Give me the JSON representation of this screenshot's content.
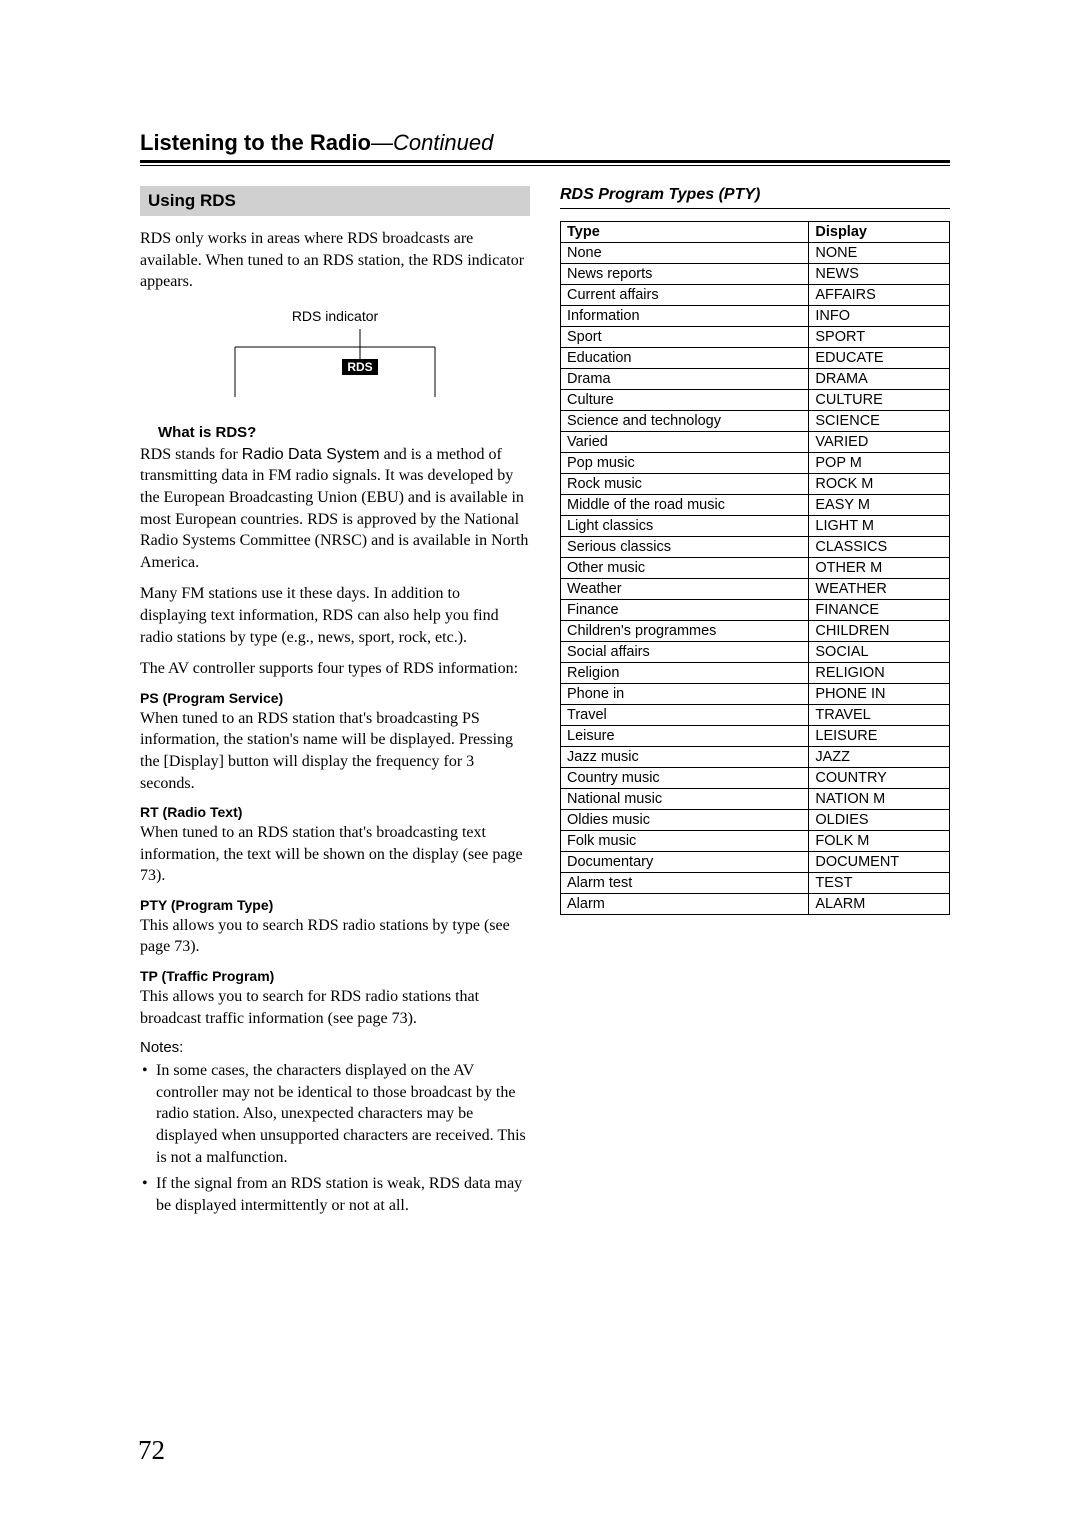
{
  "page": {
    "title_bold": "Listening to the Radio",
    "title_sep": "—",
    "title_continued": "Continued",
    "number": "72"
  },
  "left": {
    "section_header": "Using RDS",
    "intro": "RDS only works in areas where RDS broadcasts are available. When tuned to an RDS station, the RDS indicator appears.",
    "diagram_label": "RDS indicator",
    "rds_badge": "RDS",
    "what_is_heading": "What is RDS?",
    "what_is_p1_a": "RDS stands for ",
    "what_is_p1_b": "Radio Data System",
    "what_is_p1_c": " and is a method of transmitting data in FM radio signals. It was developed by the European Broadcasting Union (EBU) and is available in most European countries. RDS is approved by the National Radio Systems Committee (NRSC) and is available in North America.",
    "what_is_p2": "Many FM stations use it these days. In addition to displaying text information, RDS can also help you find radio stations by type (e.g., news, sport, rock, etc.).",
    "what_is_p3": "The AV controller supports four types of RDS information:",
    "ps_heading": "PS (Program Service)",
    "ps_text": "When tuned to an RDS station that's broadcasting PS information, the station's name will be displayed. Pressing the [Display] button will display the frequency for 3 seconds.",
    "rt_heading": "RT (Radio Text)",
    "rt_text": "When tuned to an RDS station that's broadcasting text information, the text will be shown on the display (see page 73).",
    "pty_heading": "PTY (Program Type)",
    "pty_text": "This allows you to search RDS radio stations by type (see page 73).",
    "tp_heading": "TP (Traffic Program)",
    "tp_text": "This allows you to search for RDS radio stations that broadcast traffic information (see page 73).",
    "notes_label": "Notes:",
    "note1": "In some cases, the characters displayed on the AV controller may not be identical to those broadcast by the radio station. Also, unexpected characters may be displayed when unsupported characters are received. This is not a malfunction.",
    "note2": "If the signal from an RDS station is weak, RDS data may be displayed intermittently or not at all."
  },
  "right": {
    "section_header": "RDS Program Types (PTY)",
    "chart_data": {
      "type": "table",
      "columns": [
        "Type",
        "Display"
      ],
      "rows": [
        [
          "None",
          "NONE"
        ],
        [
          "News reports",
          "NEWS"
        ],
        [
          "Current affairs",
          "AFFAIRS"
        ],
        [
          "Information",
          "INFO"
        ],
        [
          "Sport",
          "SPORT"
        ],
        [
          "Education",
          "EDUCATE"
        ],
        [
          "Drama",
          "DRAMA"
        ],
        [
          "Culture",
          "CULTURE"
        ],
        [
          "Science and technology",
          "SCIENCE"
        ],
        [
          "Varied",
          "VARIED"
        ],
        [
          "Pop music",
          "POP M"
        ],
        [
          "Rock music",
          "ROCK M"
        ],
        [
          "Middle of the road music",
          "EASY M"
        ],
        [
          "Light classics",
          "LIGHT M"
        ],
        [
          "Serious classics",
          "CLASSICS"
        ],
        [
          "Other music",
          "OTHER M"
        ],
        [
          "Weather",
          "WEATHER"
        ],
        [
          "Finance",
          "FINANCE"
        ],
        [
          "Children's programmes",
          "CHILDREN"
        ],
        [
          "Social affairs",
          "SOCIAL"
        ],
        [
          "Religion",
          "RELIGION"
        ],
        [
          "Phone in",
          "PHONE IN"
        ],
        [
          "Travel",
          "TRAVEL"
        ],
        [
          "Leisure",
          "LEISURE"
        ],
        [
          "Jazz music",
          "JAZZ"
        ],
        [
          "Country music",
          "COUNTRY"
        ],
        [
          "National music",
          "NATION M"
        ],
        [
          "Oldies music",
          "OLDIES"
        ],
        [
          "Folk music",
          "FOLK M"
        ],
        [
          "Documentary",
          "DOCUMENT"
        ],
        [
          "Alarm test",
          "TEST"
        ],
        [
          "Alarm",
          "ALARM"
        ]
      ]
    }
  }
}
